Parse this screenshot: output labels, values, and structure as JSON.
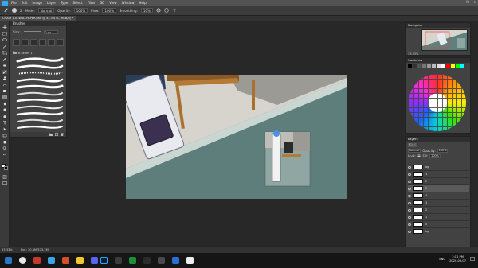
{
  "menubar": {
    "items": [
      "File",
      "Edit",
      "Image",
      "Layer",
      "Type",
      "Select",
      "Filter",
      "3D",
      "View",
      "Window",
      "Help"
    ],
    "window_controls": [
      "—",
      "❐",
      "✕"
    ]
  },
  "optionsbar": {
    "brush_size": "2",
    "mode_label": "Mode:",
    "mode": "Normal",
    "opacity_label": "Opacity:",
    "opacity": "100%",
    "flow_label": "Flow:",
    "flow": "100%",
    "smoothing_label": "Smoothing:",
    "smoothing": "10%"
  },
  "document": {
    "tab_title": "CHAIR 1.0. WALLPAPER.psd @ 33.3% (C, RGB/8) *"
  },
  "brushes_panel": {
    "title": "Brushes",
    "size_label": "Size:",
    "size_value": "2 px",
    "folder_name": "B series 1"
  },
  "navigator": {
    "title": "Navigator",
    "zoom": "33.33%"
  },
  "swatches": {
    "title": "Swatches",
    "strip_colors": [
      "#000000",
      "#333333",
      "#555555",
      "#777777",
      "#999999",
      "#bbbbbb",
      "#dddddd",
      "#ffffff",
      "#ff0000",
      "#ffff00",
      "#00ff00",
      "#00ffff"
    ]
  },
  "layers_panel": {
    "title": "Layers",
    "kind_label": "Kind",
    "blend_mode": "Normal",
    "opacity_label": "Opacity:",
    "opacity": "100%",
    "lock_label": "Lock:",
    "fill_label": "Fill:",
    "fill": "100%",
    "layers": [
      {
        "name": "bg",
        "selected": false
      },
      {
        "name": "3",
        "selected": false
      },
      {
        "name": "2",
        "selected": false
      },
      {
        "name": "5",
        "selected": true
      },
      {
        "name": "4",
        "selected": false
      },
      {
        "name": "3",
        "selected": false
      },
      {
        "name": "2",
        "selected": false
      },
      {
        "name": "1",
        "selected": false
      },
      {
        "name": "0",
        "selected": false
      },
      {
        "name": "bg",
        "selected": false
      }
    ]
  },
  "statusbar": {
    "zoom": "33.33%",
    "doc_info": "Doc: 30.4M/373.2M"
  },
  "taskbar": {
    "time": "2:11 PM",
    "date": "2020-09-07",
    "lang": "ENG"
  }
}
